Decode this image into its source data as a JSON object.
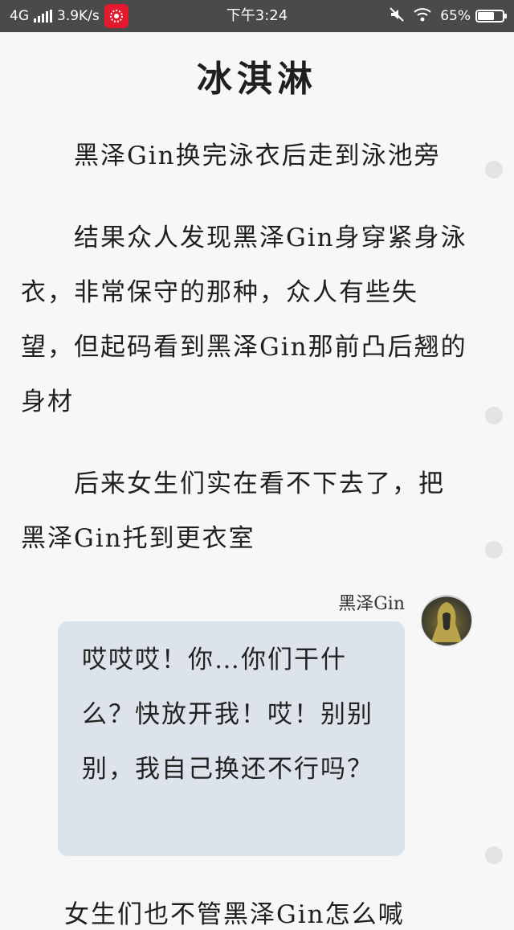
{
  "status_bar": {
    "network": "4G",
    "speed": "3.9K/s",
    "time": "下午3:24",
    "battery_percent": "65%",
    "battery_level": 0.65,
    "icons": [
      "signal-icon",
      "gift-app-icon",
      "mute-icon",
      "wifi-icon",
      "battery-icon"
    ]
  },
  "article": {
    "title": "冰淇淋",
    "paragraphs": [
      "　　黑泽Gin换完泳衣后走到泳池旁",
      "　　结果众人发现黑泽Gin身穿紧身泳衣，非常保守的那种，众人有些失望，但起码看到黑泽Gin那前凸后翘的身材",
      "　　后来女生们实在看不下去了，把黑泽Gin托到更衣室"
    ]
  },
  "dialogue": {
    "speaker": "黑泽Gin",
    "text": "哎哎哎！你…你们干什么？快放开我！哎！别别别，我自己换还不行吗？"
  },
  "partial_line": "女生们也不管黑泽Gin怎么喊"
}
